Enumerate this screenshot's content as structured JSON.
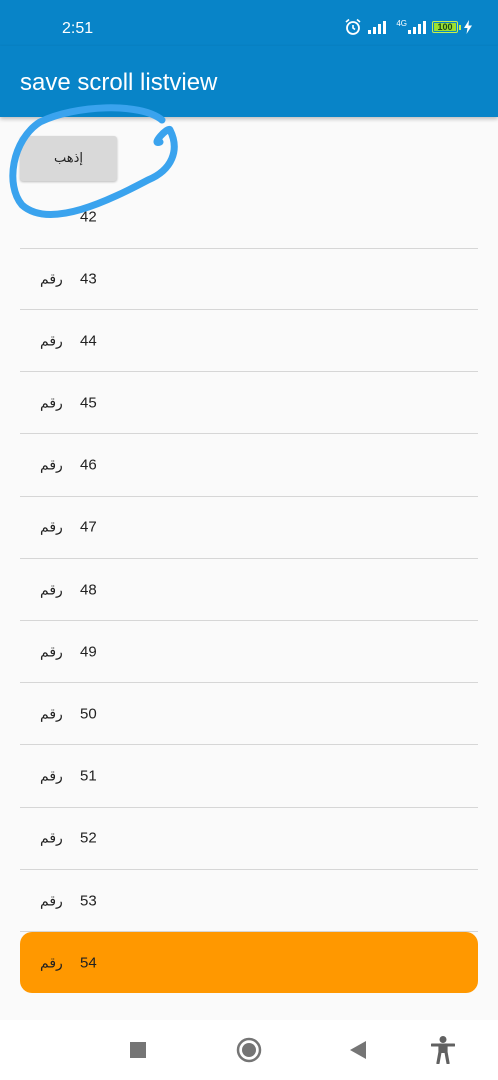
{
  "status_bar": {
    "time": "2:51",
    "network": "4G",
    "battery": "100",
    "battery_level": 1.0
  },
  "app_bar": {
    "title": "save scroll listview"
  },
  "go_button": {
    "label": "إذهب"
  },
  "list": {
    "partial_item_number": "42",
    "items": [
      {
        "label": "رقم",
        "number": "43"
      },
      {
        "label": "رقم",
        "number": "44"
      },
      {
        "label": "رقم",
        "number": "45"
      },
      {
        "label": "رقم",
        "number": "46"
      },
      {
        "label": "رقم",
        "number": "47"
      },
      {
        "label": "رقم",
        "number": "48"
      },
      {
        "label": "رقم",
        "number": "49"
      },
      {
        "label": "رقم",
        "number": "50"
      },
      {
        "label": "رقم",
        "number": "51"
      },
      {
        "label": "رقم",
        "number": "52"
      },
      {
        "label": "رقم",
        "number": "53"
      },
      {
        "label": "رقم",
        "number": "54",
        "selected": true
      }
    ]
  },
  "colors": {
    "app_bar": "#0884c8",
    "selected_item": "#ff9800",
    "annotation": "#3aa3ee"
  },
  "icons": [
    "alarm-icon",
    "signal-icon",
    "battery-icon",
    "charging-icon",
    "recents-icon",
    "home-icon",
    "back-icon",
    "accessibility-icon"
  ]
}
